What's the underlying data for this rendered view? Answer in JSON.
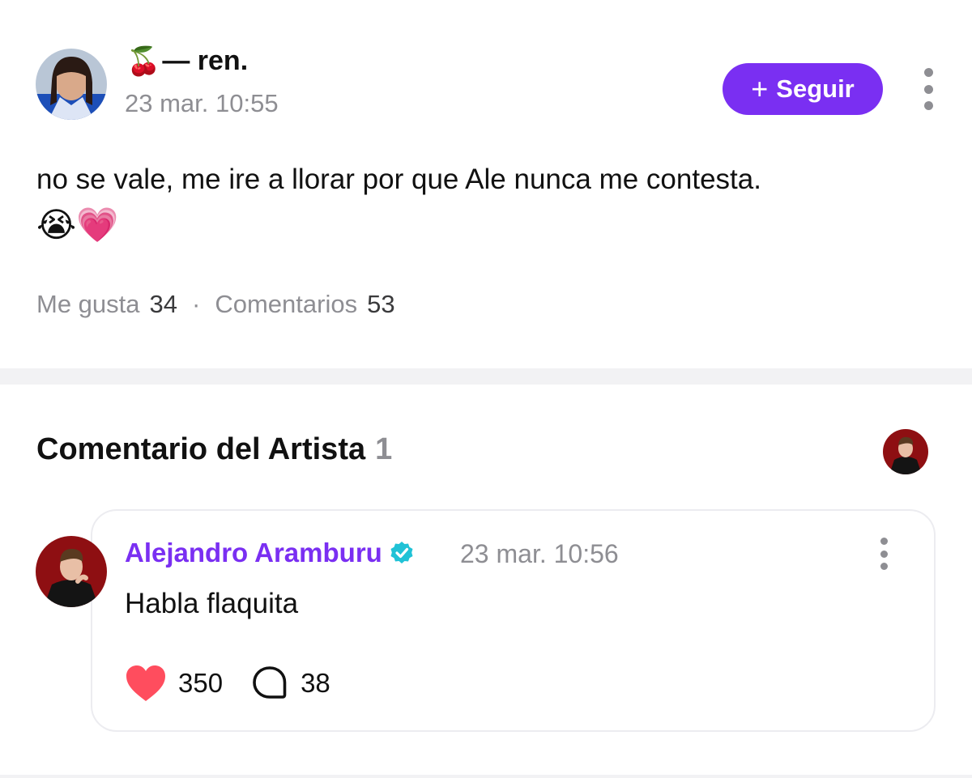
{
  "post": {
    "username_emoji": "🍒",
    "username": "— ren.",
    "timestamp": "23 mar. 10:55",
    "follow_label": "Seguir",
    "follow_icon": "plus-icon",
    "body": "no se vale, me ire a llorar por que Ale nunca me contesta.",
    "emojis": "😭💗",
    "likes_label": "Me gusta",
    "likes_count": "34",
    "separator": "·",
    "comments_label": "Comentarios",
    "comments_count": "53"
  },
  "artist_section": {
    "title": "Comentario del Artista",
    "count": "1"
  },
  "comment": {
    "author": "Alejandro Aramburu",
    "verified_icon": "verified-badge-icon",
    "timestamp": "23 mar. 10:56",
    "text": "Habla flaquita",
    "likes": "350",
    "replies": "38"
  },
  "colors": {
    "accent": "#7a2ff2",
    "verified": "#20c2d6",
    "heart": "#ff4d5e",
    "muted": "#8e8e93"
  }
}
